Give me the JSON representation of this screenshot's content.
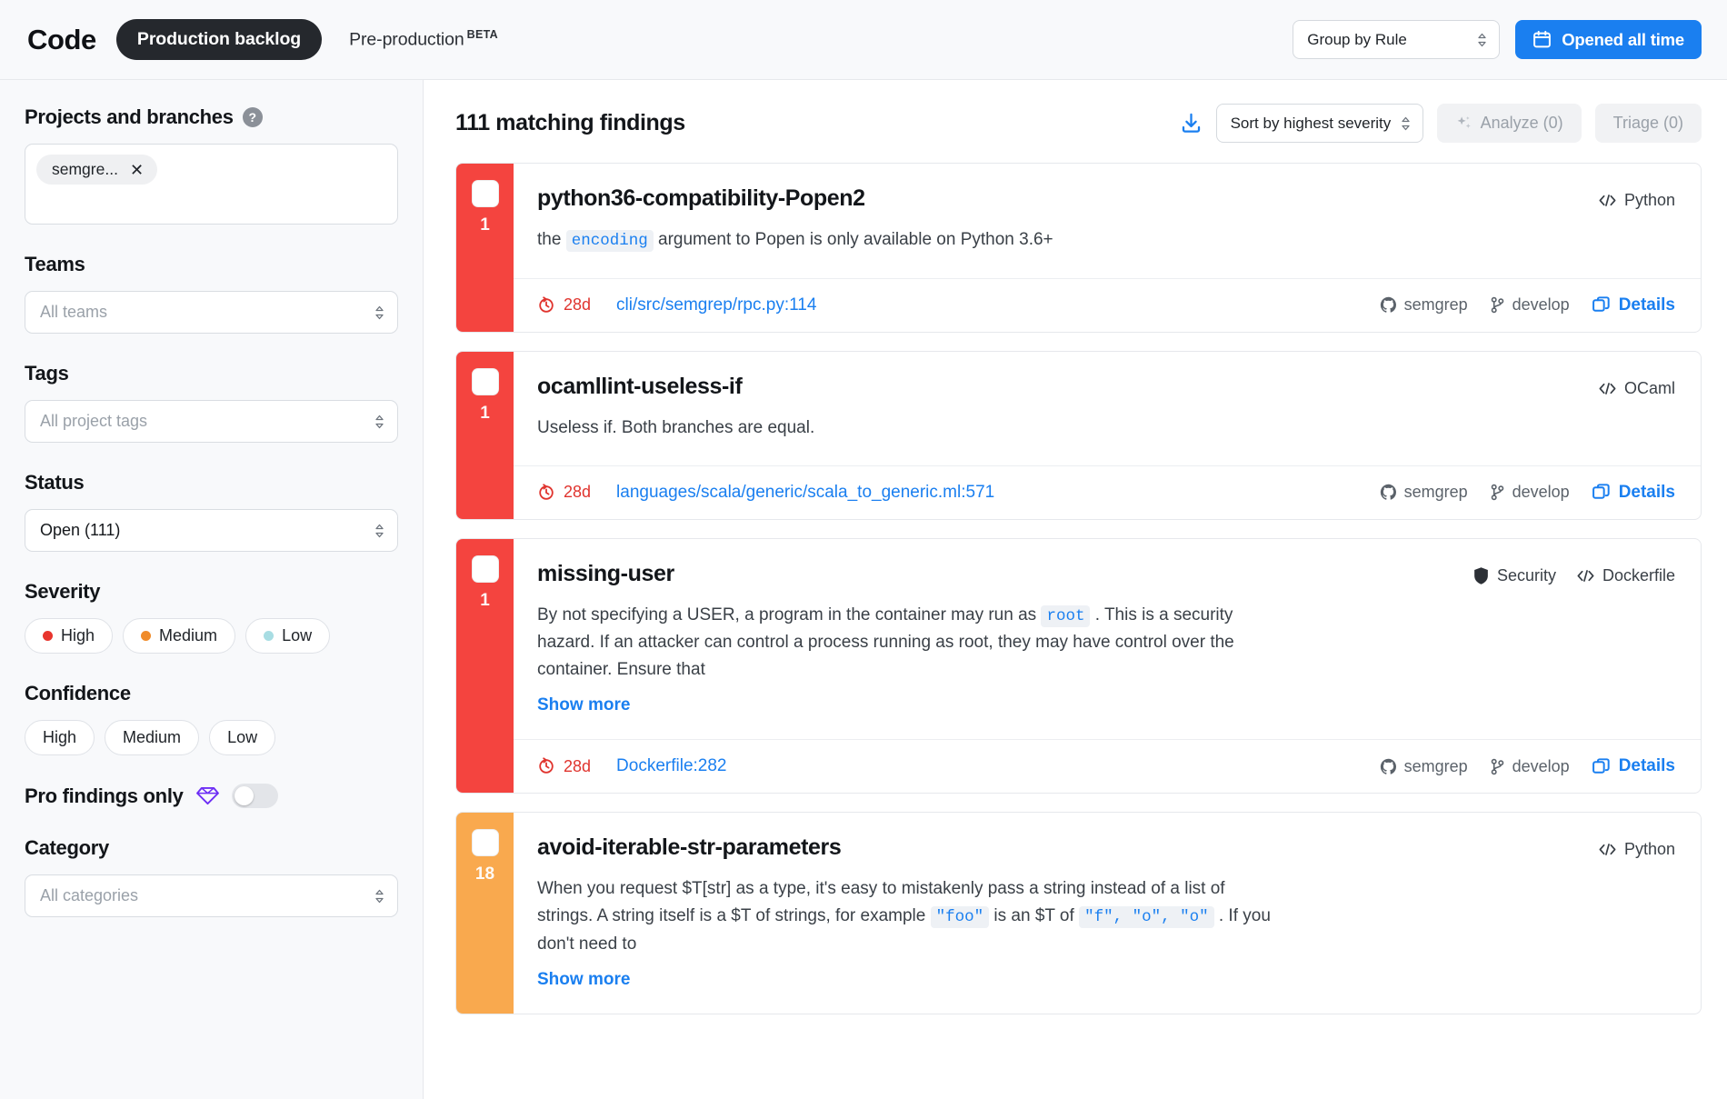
{
  "header": {
    "brand": "Code",
    "active_tab": "Production backlog",
    "second_tab": "Pre-production",
    "second_tab_badge": "BETA",
    "group_by": "Group by Rule",
    "date_button": "Opened all time"
  },
  "sidebar": {
    "projects": {
      "label": "Projects and branches",
      "help_icon": "question-icon",
      "token": "semgre...",
      "remove_icon": "close-icon"
    },
    "teams": {
      "label": "Teams",
      "placeholder": "All teams"
    },
    "tags": {
      "label": "Tags",
      "placeholder": "All project tags"
    },
    "status": {
      "label": "Status",
      "value": "Open (111)"
    },
    "severity": {
      "label": "Severity",
      "options": [
        {
          "label": "High",
          "color": "#e8352e"
        },
        {
          "label": "Medium",
          "color": "#f08b2a"
        },
        {
          "label": "Low",
          "color": "#a8dde3"
        }
      ]
    },
    "confidence": {
      "label": "Confidence",
      "options": [
        "High",
        "Medium",
        "Low"
      ]
    },
    "pro": {
      "label": "Pro findings only",
      "gem_icon": "gem-icon",
      "enabled": false
    },
    "category": {
      "label": "Category",
      "placeholder": "All categories"
    }
  },
  "toolbar": {
    "count_text": "111 matching findings",
    "download_icon": "download-icon",
    "sort_value": "Sort by highest severity",
    "analyze_label": "Analyze (0)",
    "analyze_icon": "sparkles-icon",
    "triage_label": "Triage (0)"
  },
  "findings": [
    {
      "severity": "high",
      "count": "1",
      "title": "python36-compatibility-Popen2",
      "desc_parts": [
        {
          "t": "the ",
          "code": false
        },
        {
          "t": "encoding",
          "code": true
        },
        {
          "t": " argument to Popen is only available on Python 3.6+",
          "code": false
        }
      ],
      "badges": [
        {
          "icon": "code-icon",
          "label": "Python"
        }
      ],
      "show_more": null,
      "age": "28d",
      "path": "cli/src/semgrep/rpc.py:114",
      "repo": "semgrep",
      "branch": "develop",
      "details": "Details"
    },
    {
      "severity": "high",
      "count": "1",
      "title": "ocamllint-useless-if",
      "desc_parts": [
        {
          "t": "Useless if. Both branches are equal.",
          "code": false
        }
      ],
      "badges": [
        {
          "icon": "code-icon",
          "label": "OCaml"
        }
      ],
      "show_more": null,
      "age": "28d",
      "path": "languages/scala/generic/scala_to_generic.ml:571",
      "repo": "semgrep",
      "branch": "develop",
      "details": "Details"
    },
    {
      "severity": "high",
      "count": "1",
      "title": "missing-user",
      "desc_parts": [
        {
          "t": "By not specifying a USER, a program in the container may run as ",
          "code": false
        },
        {
          "t": "root",
          "code": true
        },
        {
          "t": " . This is a security hazard. If an attacker can control a process running as root, they may have control over the container. Ensure that",
          "code": false
        }
      ],
      "badges": [
        {
          "icon": "shield-icon",
          "label": "Security"
        },
        {
          "icon": "code-icon",
          "label": "Dockerfile"
        }
      ],
      "show_more": "Show more",
      "age": "28d",
      "path": "Dockerfile:282",
      "repo": "semgrep",
      "branch": "develop",
      "details": "Details"
    },
    {
      "severity": "medium",
      "count": "18",
      "title": "avoid-iterable-str-parameters",
      "desc_parts": [
        {
          "t": "When you request $T[str] as a type, it's easy to mistakenly pass a string instead of a list of strings. A string itself is a $T of strings, for example ",
          "code": false
        },
        {
          "t": "\"foo\"",
          "code": true
        },
        {
          "t": " is an $T of ",
          "code": false
        },
        {
          "t": "\"f\", \"o\", \"o\"",
          "code": true
        },
        {
          "t": " . If you don't need to",
          "code": false
        }
      ],
      "badges": [
        {
          "icon": "code-icon",
          "label": "Python"
        }
      ],
      "show_more": "Show more",
      "age": null,
      "path": null,
      "repo": null,
      "branch": null,
      "details": null
    }
  ],
  "colors": {
    "accent_blue": "#1a7ff0",
    "severity_high": "#f4443f",
    "severity_medium": "#f9a94e",
    "age_red": "#e0342e",
    "pro_purple": "#6d2ef5"
  }
}
